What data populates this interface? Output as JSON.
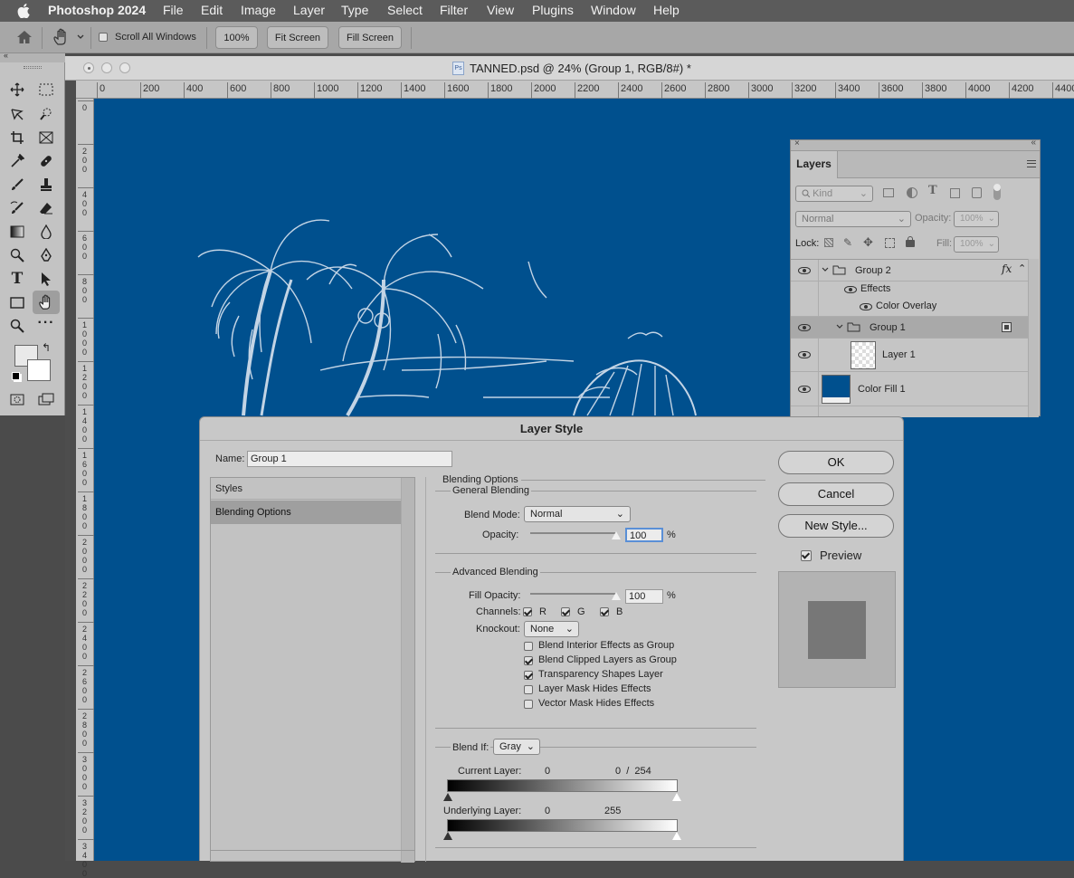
{
  "menubar": {
    "apple": "",
    "app_name": "Photoshop 2024",
    "items": [
      "File",
      "Edit",
      "Image",
      "Layer",
      "Type",
      "Select",
      "Filter",
      "View",
      "Plugins",
      "Window",
      "Help"
    ]
  },
  "options": {
    "scroll_all_windows": "Scroll All Windows",
    "zoom_100": "100%",
    "fit_screen": "Fit Screen",
    "fill_screen": "Fill Screen"
  },
  "document": {
    "title": "TANNED.psd @ 24% (Group 1, RGB/8#) *",
    "ps_badge": "Ps",
    "h_ruler": [
      "0",
      "200",
      "400",
      "600",
      "800",
      "1000",
      "1200",
      "1400",
      "1600",
      "1800",
      "2000",
      "2200",
      "2400",
      "2600",
      "2800",
      "3000",
      "3200",
      "3400",
      "3600",
      "3800",
      "4000",
      "4200",
      "4400"
    ],
    "v_ruler": [
      "0",
      "200",
      "400",
      "600",
      "800",
      "1000",
      "1200",
      "1400",
      "1600",
      "1800",
      "2000",
      "2200",
      "2400",
      "2600",
      "2800",
      "3000",
      "3200",
      "3400"
    ],
    "canvas_color": "#00508e"
  },
  "layers_panel": {
    "tab": "Layers",
    "kind": "Kind",
    "blend": "Normal",
    "opacity_label": "Opacity:",
    "opacity": "100%",
    "lock_label": "Lock:",
    "fill_label": "Fill:",
    "fill": "100%",
    "rows": {
      "group2": "Group 2",
      "fx": "fx",
      "effects": "Effects",
      "color_overlay": "Color Overlay",
      "group1": "Group 1",
      "layer1": "Layer 1",
      "colorfill": "Color Fill 1"
    }
  },
  "dialog": {
    "title": "Layer Style",
    "name_label": "Name:",
    "name_value": "Group 1",
    "styles_header": "Styles",
    "styles_selected": "Blending Options",
    "blending_options": "Blending Options",
    "general_blending": "General Blending",
    "blend_mode_label": "Blend Mode:",
    "blend_mode": "Normal",
    "opacity_label": "Opacity:",
    "opacity": "100",
    "pct": "%",
    "advanced_blending": "Advanced Blending",
    "fill_opacity_label": "Fill Opacity:",
    "fill_opacity": "100",
    "channels_label": "Channels:",
    "ch_r": "R",
    "ch_g": "G",
    "ch_b": "B",
    "knockout_label": "Knockout:",
    "knockout": "None",
    "checks": [
      {
        "label": "Blend Interior Effects as Group",
        "checked": false
      },
      {
        "label": "Blend Clipped Layers as Group",
        "checked": true
      },
      {
        "label": "Transparency Shapes Layer",
        "checked": true
      },
      {
        "label": "Layer Mask Hides Effects",
        "checked": false
      },
      {
        "label": "Vector Mask Hides Effects",
        "checked": false
      }
    ],
    "blend_if_label": "Blend If:",
    "blend_if": "Gray",
    "current_layer_label": "Current Layer:",
    "current_low": "0",
    "current_high": "0  /  254",
    "underlying_layer_label": "Underlying Layer:",
    "underlying_low": "0",
    "underlying_high": "255",
    "ok": "OK",
    "cancel": "Cancel",
    "new_style": "New Style...",
    "preview_label": "Preview",
    "opacity_level": 1.0,
    "fill_opacity_level": 1.0
  }
}
